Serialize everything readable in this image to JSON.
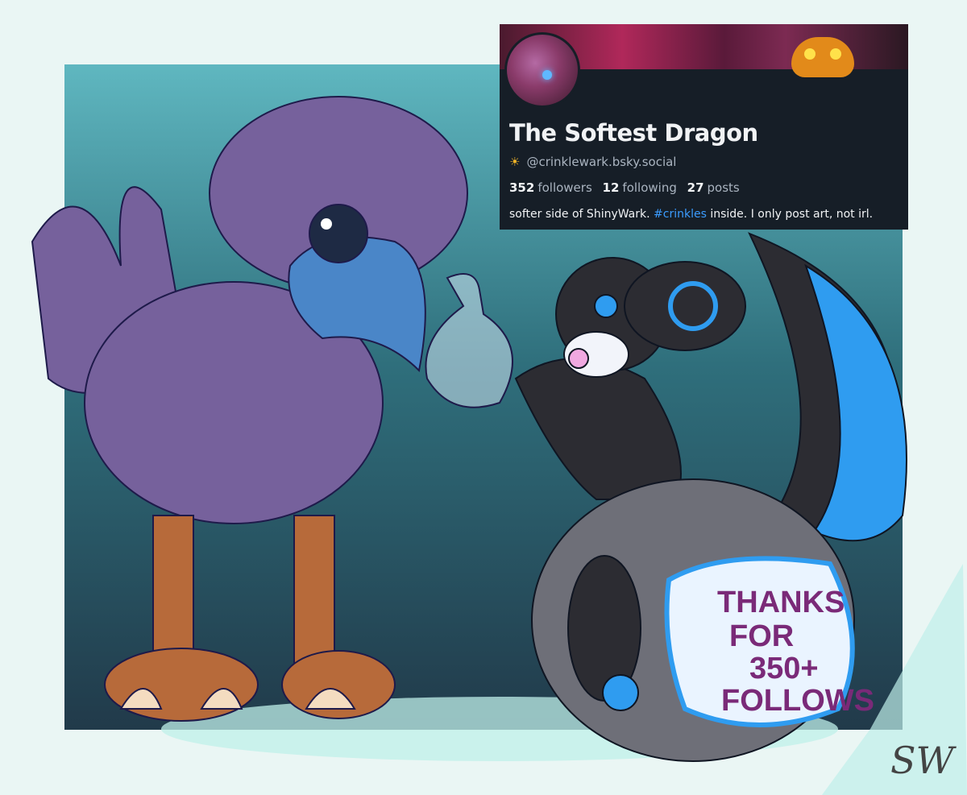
{
  "profile": {
    "display_name": "The Softest Dragon",
    "handle_icon": "sun-icon",
    "handle": "@crinklewark.bsky.social",
    "stats": {
      "followers_count": "352",
      "followers_label": "followers",
      "following_count": "12",
      "following_label": "following",
      "posts_count": "27",
      "posts_label": "posts"
    },
    "bio": {
      "before": "softer side of ShinyWark. ",
      "hashtag": "#crinkles",
      "after": " inside. I only post art, not irl."
    }
  },
  "artwork": {
    "diaper_text": [
      "THANKS",
      "FOR",
      "350+",
      "FOLLOWS"
    ],
    "signature": "SW"
  },
  "colors": {
    "card_bg": "#161e27",
    "hashtag": "#3b9cff",
    "bird_purple": "#76619c",
    "beak_blue": "#4a86c8",
    "dragon_black": "#2c2c32",
    "dragon_blue": "#2f9cf0",
    "diaper_text": "#7a2a78"
  }
}
